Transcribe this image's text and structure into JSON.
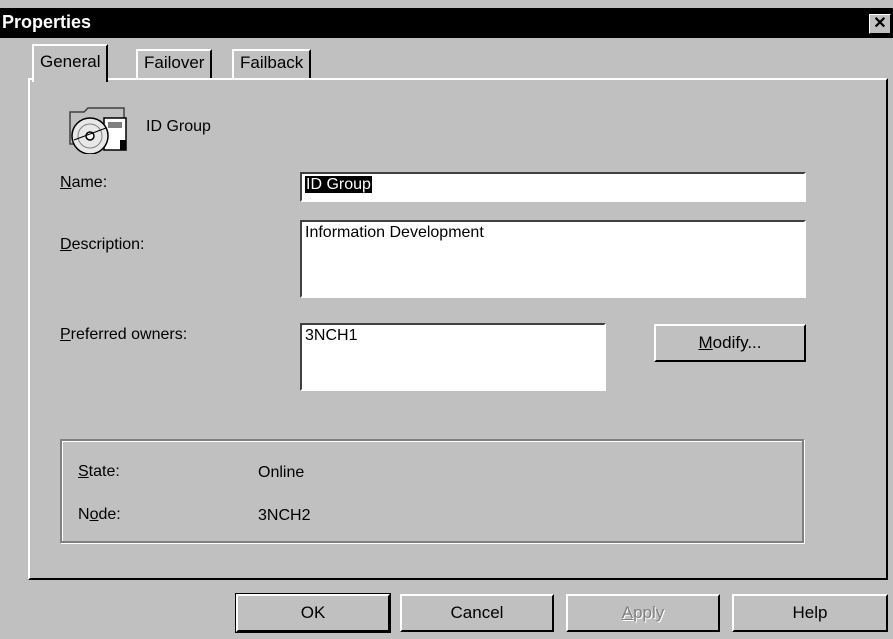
{
  "window": {
    "title": "Properties",
    "close_glyph": "✕"
  },
  "tabs": [
    {
      "label": "General",
      "active": true
    },
    {
      "label": "Failover",
      "active": false
    },
    {
      "label": "Failback",
      "active": false
    }
  ],
  "group": {
    "name_display": "ID Group",
    "icon": "cluster-group-icon"
  },
  "fields": {
    "name_label_hot": "N",
    "name_label_rest": "ame:",
    "name_value": "ID Group",
    "description_label_hot": "D",
    "description_label_rest": "escription:",
    "description_value": "Information Development",
    "owners_label_hot": "P",
    "owners_label_rest": "referred owners:",
    "owners": [
      "3NCH1"
    ],
    "modify_hot": "M",
    "modify_rest": "odify..."
  },
  "status": {
    "state_label_hot": "S",
    "state_label_rest": "tate:",
    "state_value": "Online",
    "node_label_pre": "N",
    "node_label_hot": "o",
    "node_label_rest": "de:",
    "node_value": "3NCH2"
  },
  "buttons": {
    "ok": "OK",
    "cancel": "Cancel",
    "apply_hot": "A",
    "apply_rest": "pply",
    "help": "Help"
  },
  "colors": {
    "face": "#c0c0c0",
    "titlebar": "#000000",
    "disabled_text": "#808080"
  }
}
